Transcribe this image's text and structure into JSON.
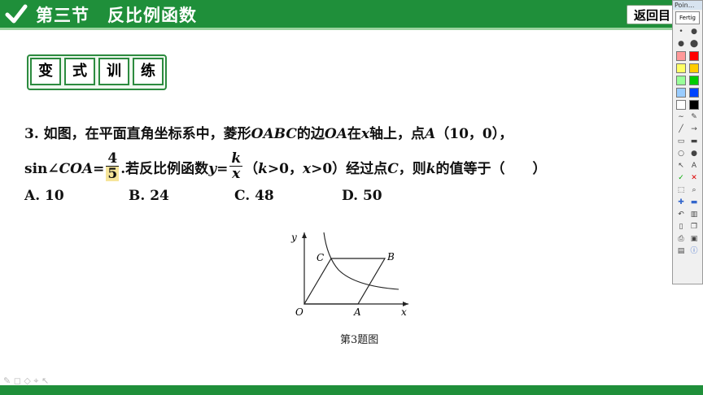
{
  "header": {
    "chapter": "第三节",
    "title": "反比例函数",
    "back_label": "返回目"
  },
  "badges": [
    "变",
    "式",
    "训",
    "练"
  ],
  "question": {
    "line1": {
      "number": "3.",
      "t1": "如图，在平面直角坐标系中，菱形",
      "v1": "OABC",
      "t2": "的边",
      "v2": "OA",
      "t3": "在",
      "v3": "x",
      "t4": "轴上，点",
      "v4": "A",
      "t5": "（10，0），"
    },
    "line2": {
      "sin": "sin∠",
      "v1": "COA",
      "eq": "=",
      "num": "4",
      "den": "5",
      "t1": ".若反比例函数",
      "v2": "y",
      "eq2": "=",
      "fnum": "k",
      "fden": "x",
      "t2": "（",
      "v3": "k",
      "t3": ">0，",
      "v4": "x",
      "t4": ">0）经过点",
      "v5": "C",
      "t5": "，则",
      "v6": "k",
      "t6": "的值等于（　　）"
    }
  },
  "options": [
    {
      "label": "A. 10"
    },
    {
      "label": "B. 24"
    },
    {
      "label": "C. 48"
    },
    {
      "label": "D. 50"
    }
  ],
  "figure": {
    "labels": {
      "y": "y",
      "x": "x",
      "O": "O",
      "A": "A",
      "B": "B",
      "C": "C"
    },
    "caption": "第3题图"
  },
  "toolbar": {
    "title": "Poin...",
    "done_label": "Fertig",
    "colors": [
      "#ff9999",
      "#ff0000",
      "#ffff66",
      "#ffcc00",
      "#99ff99",
      "#00cc00",
      "#99ccff",
      "#0044ff",
      "#ffffff",
      "#000000"
    ]
  },
  "colors": {
    "brand_green": "#1f8f3a",
    "highlight": "#f6e59a"
  }
}
